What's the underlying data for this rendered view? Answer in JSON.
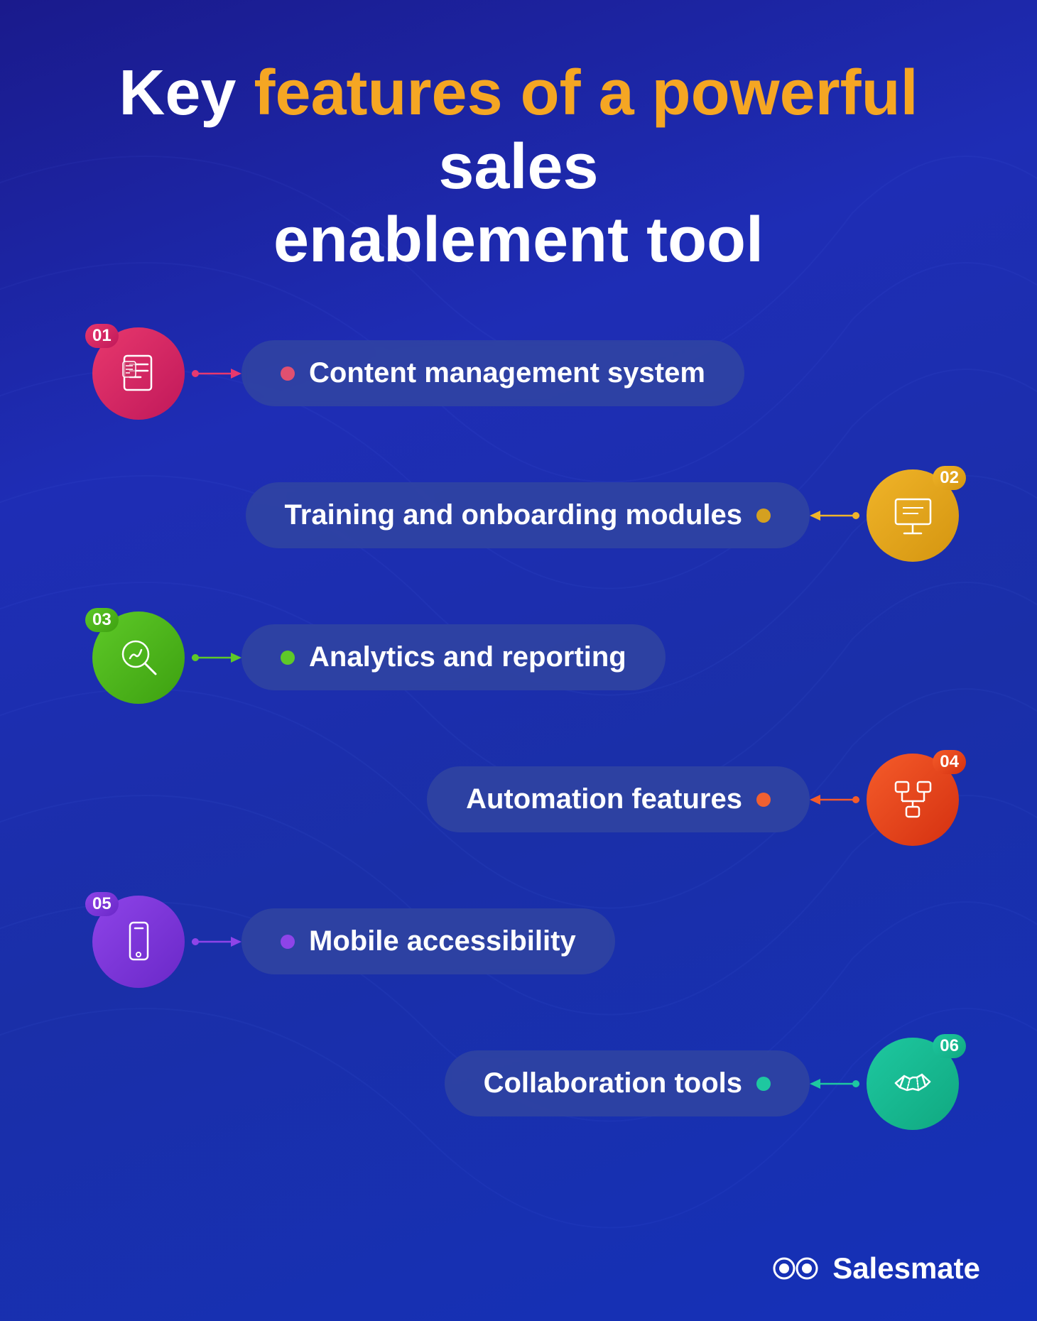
{
  "title": {
    "line1": "Key features of a powerful sales",
    "line2": "enablement tool",
    "highlight_words": [
      "features",
      "of",
      "a",
      "powerful"
    ],
    "normal_words": [
      "Key",
      "sales",
      "enablement",
      "tool"
    ]
  },
  "features": [
    {
      "number": "01",
      "label": "Content management system",
      "color": "pink",
      "side": "left",
      "icon": "document"
    },
    {
      "number": "02",
      "label": "Training and onboarding modules",
      "color": "yellow",
      "side": "right",
      "icon": "presentation"
    },
    {
      "number": "03",
      "label": "Analytics and reporting",
      "color": "green",
      "side": "left",
      "icon": "analytics"
    },
    {
      "number": "04",
      "label": "Automation features",
      "color": "orange",
      "side": "right",
      "icon": "automation"
    },
    {
      "number": "05",
      "label": "Mobile accessibility",
      "color": "purple",
      "side": "left",
      "icon": "mobile"
    },
    {
      "number": "06",
      "label": "Collaboration tools",
      "color": "teal",
      "side": "right",
      "icon": "handshake"
    }
  ],
  "logo": {
    "name": "Salesmate"
  }
}
